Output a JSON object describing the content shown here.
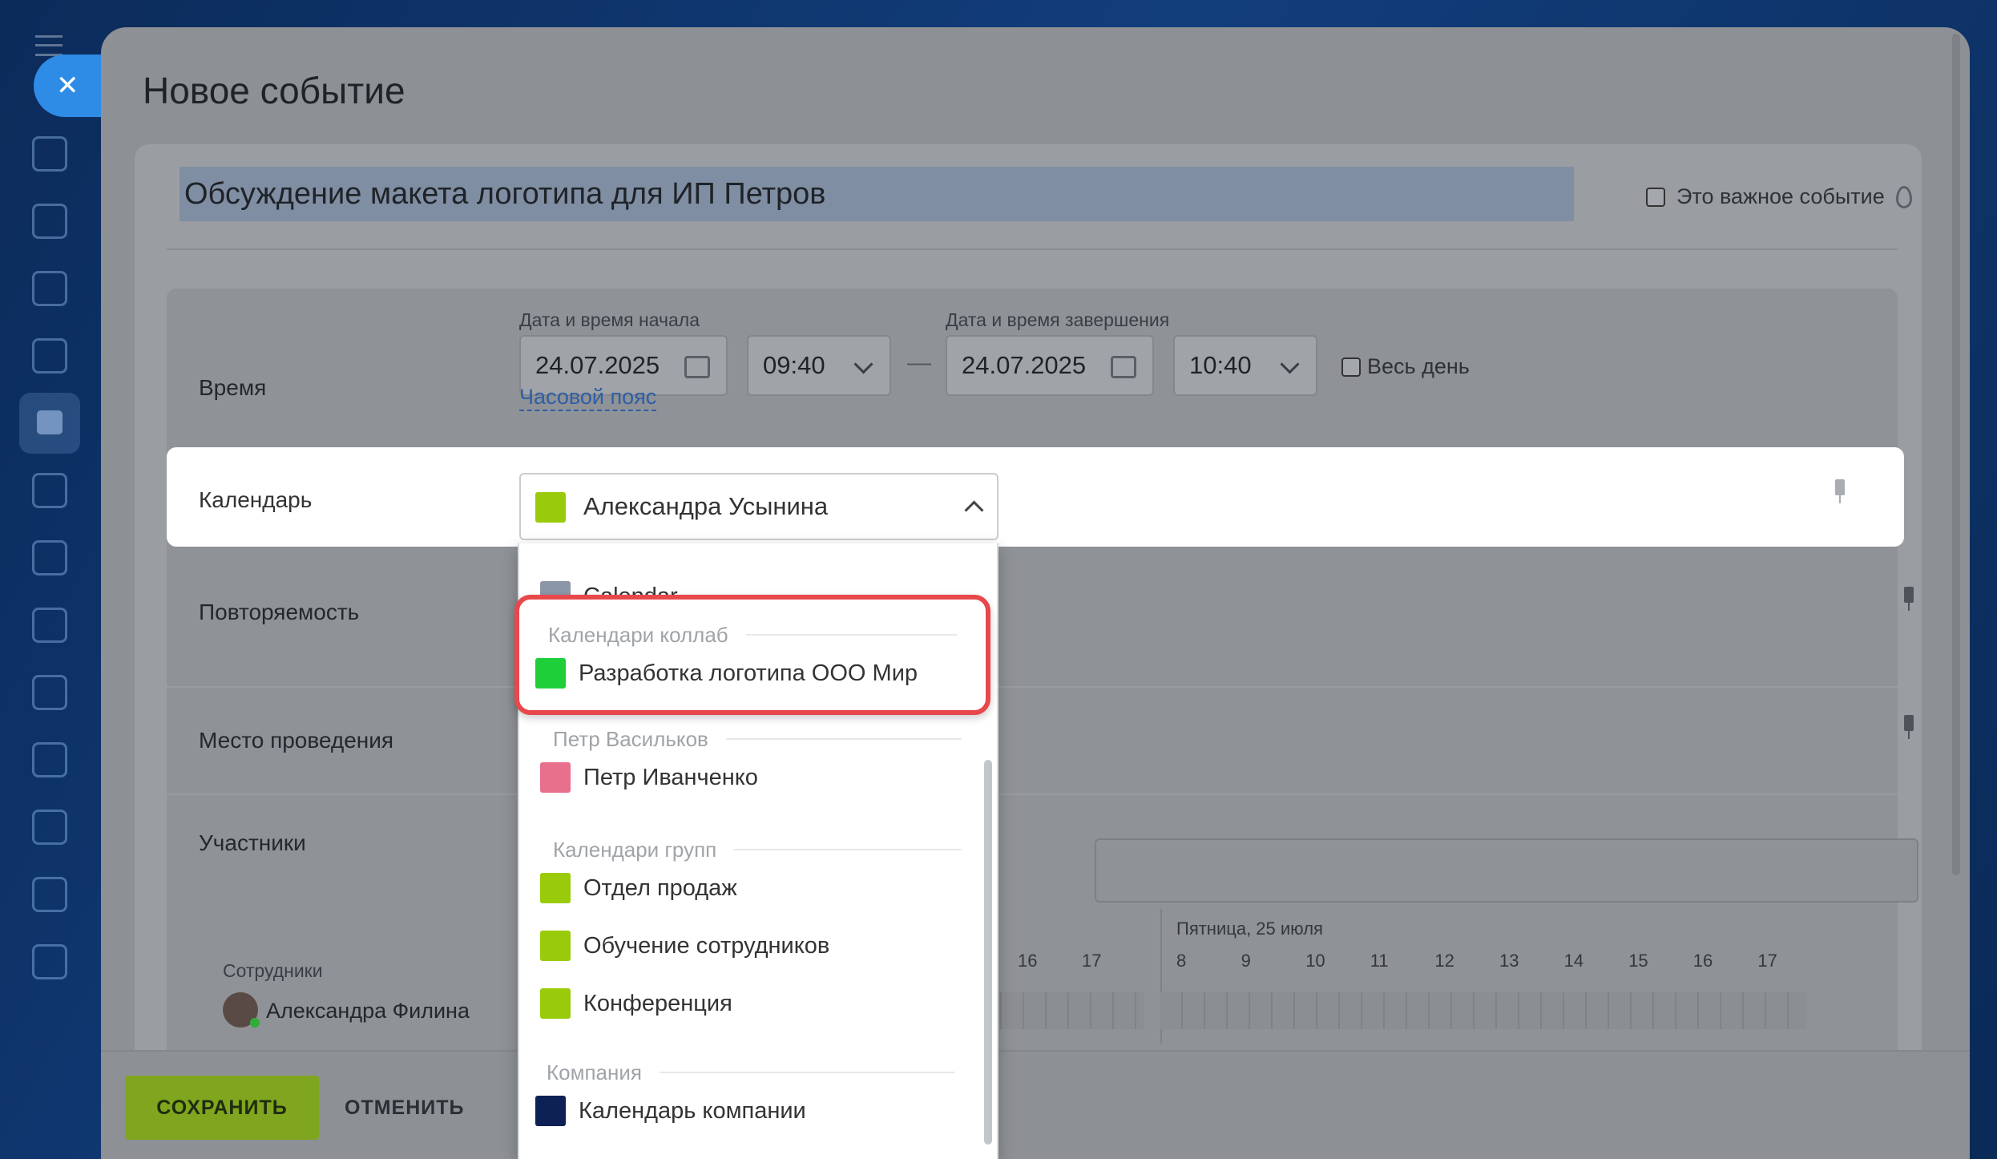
{
  "window": {
    "title": "Новое событие",
    "close_glyph": "✕"
  },
  "event": {
    "name": "Обсуждение макета логотипа для ИП Петров",
    "important_label": "Это важное событие"
  },
  "time": {
    "row_label": "Время",
    "start_label": "Дата и время начала",
    "start_date": "24.07.2025",
    "start_time": "09:40",
    "dash": "—",
    "end_label": "Дата и время завершения",
    "end_date": "24.07.2025",
    "end_time": "10:40",
    "all_day_label": "Весь день",
    "timezone_link": "Часовой пояс"
  },
  "calendar": {
    "row_label": "Календарь",
    "selected": "Александра Усынина",
    "selected_color": "#9acb0a"
  },
  "dropdown": {
    "item_calendar": {
      "label": "Calendar",
      "color": "#8b97a8"
    },
    "group_collab": "Календари коллаб",
    "item_collab": {
      "label": "Разработка логотипа ООО Мир",
      "color": "#1fcf3a"
    },
    "group_petr": "Петр Васильков",
    "item_petr": {
      "label": "Петр Иванченко",
      "color": "#e8708c"
    },
    "group_groups": "Календари групп",
    "item_sales": {
      "label": "Отдел продаж",
      "color": "#9acb0a"
    },
    "item_training": {
      "label": "Обучение сотрудников",
      "color": "#9acb0a"
    },
    "item_conference": {
      "label": "Конференция",
      "color": "#9acb0a"
    },
    "group_company": "Компания",
    "item_company": {
      "label": "Календарь компании",
      "color": "#0d2154"
    }
  },
  "rows": {
    "repeat_label": "Повторяемость",
    "place_label": "Место проведения",
    "participants_label": "Участники"
  },
  "timeline": {
    "day_label": "Пятница, 25 июля",
    "left_hours": [
      "16",
      "17"
    ],
    "right_hours": [
      "8",
      "9",
      "10",
      "11",
      "12",
      "13",
      "14",
      "15",
      "16",
      "17"
    ],
    "employees_label": "Сотрудники",
    "employee_name": "Александра Филина"
  },
  "actions": {
    "save": "СОХРАНИТЬ",
    "cancel": "ОТМЕНИТЬ"
  },
  "colors": {
    "accent_green": "#7fa61e",
    "highlight_red": "#e8484b"
  }
}
